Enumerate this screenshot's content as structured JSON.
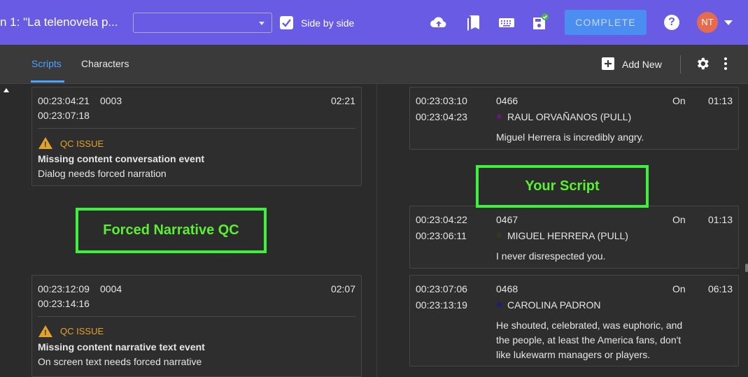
{
  "header": {
    "title": "n 1: \"La telenovela p...",
    "side_by_side_label": "Side by side",
    "complete_label": "COMPLETE",
    "help_glyph": "?",
    "avatar_initials": "NT",
    "icons": [
      "cloud-upload-icon",
      "bookmarks-icon",
      "keyboard-icon",
      "save-synced-icon",
      "help-icon"
    ]
  },
  "tabs": [
    {
      "label": "Scripts",
      "active": true
    },
    {
      "label": "Characters",
      "active": false
    }
  ],
  "toolbar": {
    "add_new_label": "Add New"
  },
  "left_cards": [
    {
      "start": "00:23:04:21",
      "id": "0003",
      "end": "00:23:07:18",
      "duration": "02:21",
      "qc_label": "QC ISSUE",
      "issue_title": "Missing content conversation event",
      "issue_detail": "Dialog needs forced narration"
    },
    {
      "start": "00:23:12:09",
      "id": "0004",
      "end": "00:23:14:16",
      "duration": "02:07",
      "qc_label": "QC ISSUE",
      "issue_title": "Missing content narrative text event",
      "issue_detail": "On screen text needs forced narrative"
    }
  ],
  "right_cards": [
    {
      "start": "00:23:03:10",
      "end": "00:23:04:23",
      "id": "0466",
      "status": "On",
      "duration": "01:13",
      "character": "RAUL ORVAÑANOS (PULL)",
      "dot_color": "#5a1f73",
      "lines": [
        "Miguel Herrera is incredibly angry."
      ]
    },
    {
      "start": "00:23:04:22",
      "end": "00:23:06:11",
      "id": "0467",
      "status": "On",
      "duration": "01:13",
      "character": "MIGUEL HERRERA (PULL)",
      "dot_color": "#3a3522",
      "lines": [
        "I never disrespected you."
      ]
    },
    {
      "start": "00:23:07:06",
      "end": "00:23:13:19",
      "id": "0468",
      "status": "On",
      "duration": "06:13",
      "character": "CAROLINA PADRON",
      "dot_color": "#1c1f7a",
      "lines": [
        "He shouted, celebrated, was euphoric, and",
        "the people, at least the America fans, don't",
        "like lukewarm managers or players."
      ]
    }
  ],
  "annotations": {
    "left": "Forced Narrative QC",
    "right": "Your Script"
  },
  "colors": {
    "header_bg": "#6a5be4",
    "accent": "#4aa3ff",
    "warning": "#e3a32a",
    "annotation": "#3df23a"
  }
}
